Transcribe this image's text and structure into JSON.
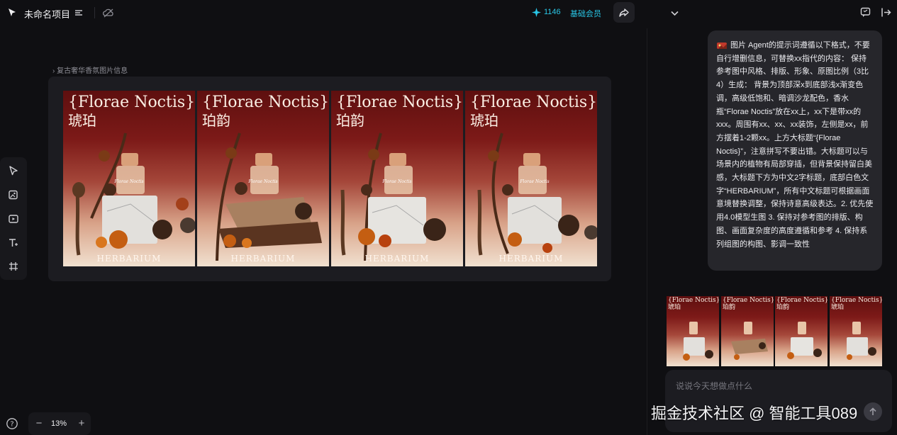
{
  "topbar": {
    "title": "未命名项目",
    "credits": "1146",
    "membership": "基础会员"
  },
  "canvas": {
    "group_label": "复古奢华香氛图片信息",
    "posters": [
      {
        "title": "{Florae Noctis}",
        "subtitle": "琥珀",
        "bottom_text": "HERBARIUM",
        "bottle_label": "Florae Noctis"
      },
      {
        "title": "{Florae Noctis}",
        "subtitle": "珀韵",
        "bottom_text": "HERBARIUM",
        "bottle_label": "Florae Noctis"
      },
      {
        "title": "{Florae Noctis}",
        "subtitle": "珀韵",
        "bottom_text": "HERBARIUM",
        "bottle_label": "Florae Noctis"
      },
      {
        "title": "{Florae Noctis}",
        "subtitle": "琥珀",
        "bottom_text": "HERBARIUM",
        "bottle_label": "Florae Noctis"
      }
    ],
    "colors": {
      "bg_top": "#5e0f0f",
      "bg_mid": "#a5473a",
      "bg_bottom": "#f1e1d0",
      "title_text": "#fbefe4"
    }
  },
  "zoom": {
    "minus": "−",
    "value": "13%",
    "plus": "+"
  },
  "chat": {
    "message": "图片 Agent的提示词遵循以下格式，不要自行增删信息，可替换xx指代的内容： 保持参考图中风格、排版、形象、原图比例（3比4）生成： 背景为顶部深x到底部浅x渐变色调，高级低饱和、暗调沙龙配色，香水瓶“Florae Noctis”放在xx上，xx下是带xx的xxx。周围有xx、xx、xx装饰，左侧是xx，前方摆着1-2颗xx。上方大标题“{Florae Noctis}”，注意拼写不要出错。大标题可以与场景内的植物有局部穿插，但背景保持留白美感，大标题下方为中文2字标题，底部白色文字“HERBARIUM”，所有中文标题可根据画面意境替换调整，保持诗意高级表达。2. 优先使用4.0模型生图 3. 保持对参考图的排版、构图、画面复杂度的高度遵循和参考 4. 保持系列组图的构图、影调一致性",
    "thumbnails": [
      {
        "title": "{Florae Noctis}",
        "subtitle": "琥珀"
      },
      {
        "title": "{Florae Noctis}",
        "subtitle": "珀韵"
      },
      {
        "title": "{Florae Noctis}",
        "subtitle": "珀韵"
      },
      {
        "title": "{Florae Noctis}",
        "subtitle": "琥珀"
      }
    ],
    "input_placeholder": "说说今天想做点什么",
    "icons": {
      "logo": "cursor-logo-icon",
      "accent": "#29c6e6"
    }
  },
  "watermark": "掘金技术社区 @ 智能工具089"
}
